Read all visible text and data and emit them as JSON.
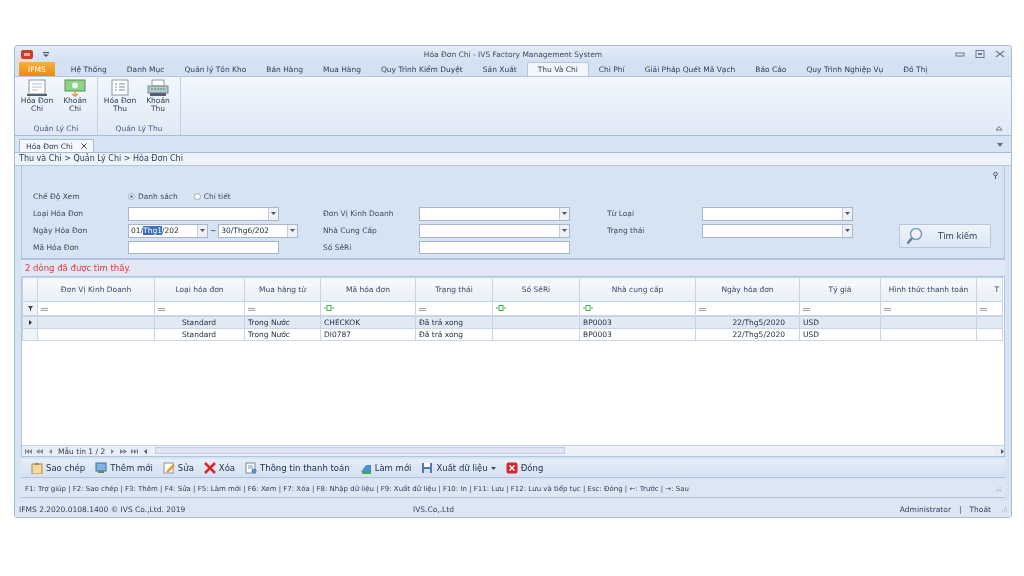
{
  "window": {
    "title": "Hóa Đơn Chi - IVS Factory Management System"
  },
  "app_button": "IFMS",
  "ribbon_tabs": [
    {
      "label": "Hệ Thống",
      "selected": false
    },
    {
      "label": "Danh Mục",
      "selected": false
    },
    {
      "label": "Quản lý Tồn Kho",
      "selected": false
    },
    {
      "label": "Bán Hàng",
      "selected": false
    },
    {
      "label": "Mua Hàng",
      "selected": false
    },
    {
      "label": "Quy Trình Kiểm Duyệt",
      "selected": false
    },
    {
      "label": "Sản Xuất",
      "selected": false
    },
    {
      "label": "Thu Và Chi",
      "selected": true
    },
    {
      "label": "Chi Phí",
      "selected": false
    },
    {
      "label": "Giải Pháp Quét Mã Vạch",
      "selected": false
    },
    {
      "label": "Báo Cáo",
      "selected": false
    },
    {
      "label": "Quy Trình Nghiệp Vụ",
      "selected": false
    },
    {
      "label": "Đồ Thị",
      "selected": false
    }
  ],
  "ribbon_groups": [
    {
      "label": "Quản Lý Chi",
      "buttons": [
        "Hóa Đơn Chi",
        "Khoản Chi"
      ]
    },
    {
      "label": "Quản Lý Thu",
      "buttons": [
        "Hóa Đơn Thu",
        "Khoản Thu"
      ]
    }
  ],
  "doc_tabs": [
    {
      "label": "Hóa Đơn Chi",
      "selected": true
    }
  ],
  "breadcrumb": "Thu và Chi > Quản Lý Chi > Hóa Đơn Chi",
  "filters": {
    "view_mode": {
      "label": "Chế Độ Xem",
      "options": [
        {
          "label": "Danh sách",
          "selected": true
        },
        {
          "label": "Chi tiết",
          "selected": false
        }
      ]
    },
    "columns": [
      [
        {
          "kind": "combo",
          "label": "Loại Hóa Đơn"
        },
        {
          "kind": "date_range",
          "label": "Ngày Hóa Đơn",
          "from": {
            "before": "01/",
            "highlighted": "Thg1",
            "after": "/202"
          },
          "separator": "~",
          "to": "30/Thg6/202"
        },
        {
          "kind": "text",
          "label": "Mã Hóa Đơn"
        }
      ],
      [
        {
          "kind": "combo",
          "label": "Đơn Vị Kinh Doanh"
        },
        {
          "kind": "combo",
          "label": "Nhà Cung Cấp"
        },
        {
          "kind": "text",
          "label": "Số SêRi"
        }
      ],
      [
        {
          "kind": "combo",
          "label": "Từ Loại"
        },
        {
          "kind": "combo",
          "label": "Trạng thái"
        }
      ]
    ],
    "search_button": "Tìm kiếm"
  },
  "result_message": "2 dòng đã được tìm thấy.",
  "table": {
    "columns": [
      {
        "label": "Đơn Vị Kinh Doanh",
        "kind": "equals"
      },
      {
        "label": "Loại hóa đơn",
        "kind": "equals"
      },
      {
        "label": "Mua hàng từ",
        "kind": "equals"
      },
      {
        "label": "Mã hóa đơn",
        "kind": "contains"
      },
      {
        "label": "Trạng thái",
        "kind": "equals"
      },
      {
        "label": "Số SêRi",
        "kind": "contains"
      },
      {
        "label": "Nhà cung cấp",
        "kind": "contains"
      },
      {
        "label": "Ngày hóa đơn",
        "kind": "equals"
      },
      {
        "label": "Tỷ giá",
        "kind": "equals"
      },
      {
        "label": "Hình thức thanh toán",
        "kind": "equals"
      },
      {
        "label": "T",
        "kind": "equals"
      }
    ],
    "rows": [
      {
        "selected": true,
        "cells": [
          null,
          "Standard",
          "Trong Nước",
          "CHECKOK",
          "Đã trả xong",
          null,
          "BP0003",
          "22/Thg5/2020",
          "USD",
          null,
          null
        ]
      },
      {
        "selected": false,
        "cells": [
          null,
          "Standard",
          "Trong Nước",
          "DI0787",
          "Đã trả xong",
          null,
          "BP0003",
          "22/Thg5/2020",
          "USD",
          null,
          null
        ]
      }
    ],
    "record_navigator": "Mẫu tin 1 / 2"
  },
  "toolbar": [
    {
      "label": "Sao chép",
      "dropdown": false
    },
    {
      "label": "Thêm mới",
      "dropdown": false
    },
    {
      "label": "Sửa",
      "dropdown": false
    },
    {
      "label": "Xóa",
      "dropdown": false
    },
    {
      "label": "Thông tin thanh toán",
      "dropdown": false
    },
    {
      "label": "Làm mới",
      "dropdown": false
    },
    {
      "label": "Xuất dữ liệu",
      "dropdown": true
    },
    {
      "label": "Đóng",
      "dropdown": false
    }
  ],
  "shortcut_bar": "F1: Trợ giúp | F2: Sao chép | F3: Thêm | F4: Sửa | F5: Làm mới | F6: Xem | F7: Xóa | F8: Nhập dữ liệu | F9: Xuất dữ liệu | F10: In | F11: Lưu | F12: Lưu và tiếp tục | Esc: Đóng | ←: Trước | →: Sau",
  "status_bar": {
    "version": "IFMS 2.2020.0108.1400 © IVS Co.,Ltd. 2019",
    "company": "IVS.Co,.Ltd",
    "user": "Administrator",
    "separator": "|",
    "logout": "Thoát"
  }
}
